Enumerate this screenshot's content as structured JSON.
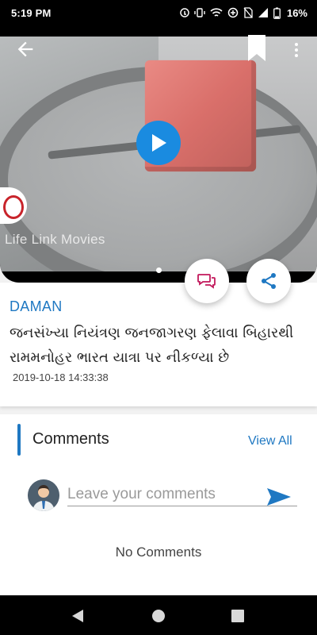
{
  "status_bar": {
    "time": "5:19 PM",
    "battery": "16%"
  },
  "video": {
    "watermark": "Life Link Movies"
  },
  "article": {
    "location": "DAMAN",
    "headline": "જનસંખ્યા નિયંત્રણ જનજાગરણ ફેલાવા બિહારથી રામમનોહર ભારત યાત્રા પર નીકળ્યા છે",
    "timestamp": "2019-10-18 14:33:38"
  },
  "comments": {
    "title": "Comments",
    "view_all": "View All",
    "placeholder": "Leave your comments",
    "empty_text": "No Comments"
  },
  "colors": {
    "accent": "#1f78c2",
    "play": "#1a8be0",
    "comment_icon": "#c2185b"
  }
}
